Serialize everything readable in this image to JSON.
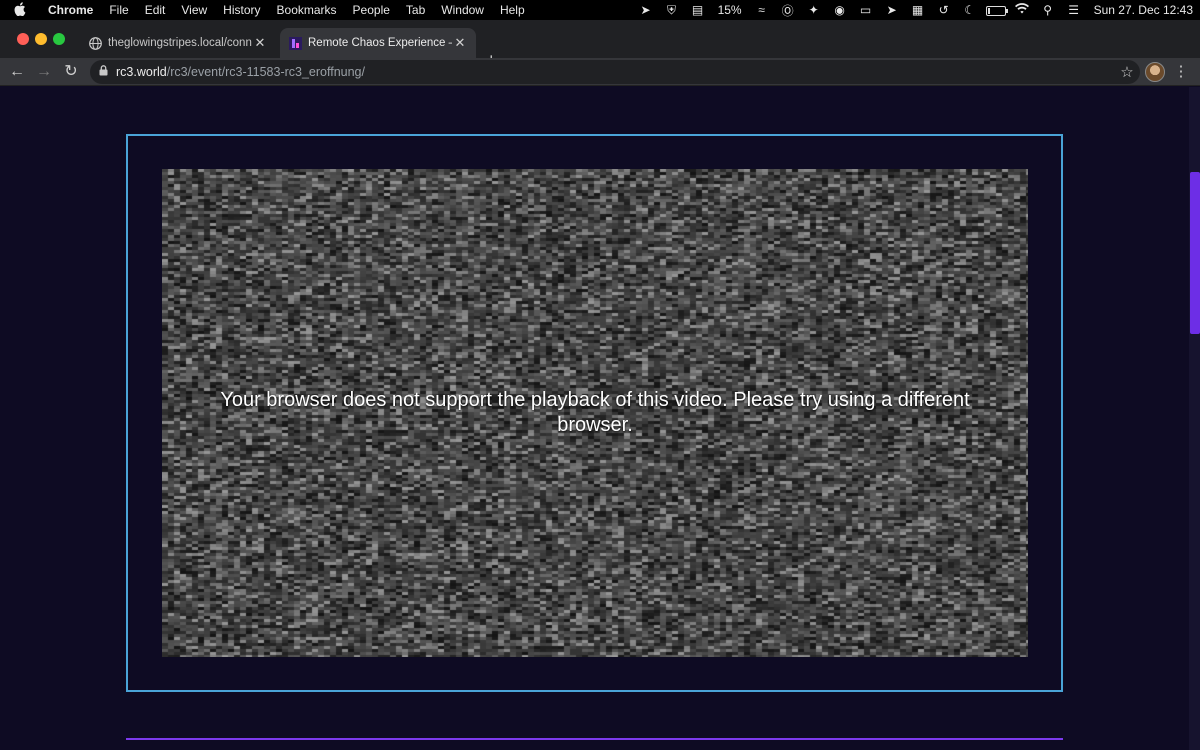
{
  "menubar": {
    "app_name": "Chrome",
    "menus": [
      "File",
      "Edit",
      "View",
      "History",
      "Bookmarks",
      "People",
      "Tab",
      "Window",
      "Help"
    ],
    "battery_percent": "15%",
    "battery_level": 0.15,
    "datetime": "Sun 27. Dec  12:43",
    "status_icons": [
      "location-arrow-icon",
      "shield-icon",
      "cpu-meter-icon",
      "airdrop-icon",
      "onepassword-icon",
      "pin-icon",
      "record-icon",
      "screen-mirror-icon",
      "telegram-icon",
      "calendar-icon",
      "time-machine-icon",
      "moon-icon",
      "battery-icon",
      "wifi-icon",
      "spotlight-icon",
      "control-center-icon"
    ]
  },
  "browser": {
    "tabs": [
      {
        "title": "theglowingstripes.local/connec",
        "favicon": "globe-icon",
        "active": false
      },
      {
        "title": "Remote Chaos Experience – Ev",
        "favicon": "rc3-logo-icon",
        "active": true
      }
    ],
    "url_host": "rc3.world",
    "url_path": "/rc3/event/rc3-11583-rc3_eroffnung/"
  },
  "page": {
    "video_message": "Your browser does not support the playback of this video. Please try using a different browser."
  },
  "colors": {
    "page_bg": "#0e0b23",
    "frame_border": "#4aa4d8",
    "accent_purple": "#7c3aed",
    "scroll_thumb": "#6d2ee6"
  }
}
